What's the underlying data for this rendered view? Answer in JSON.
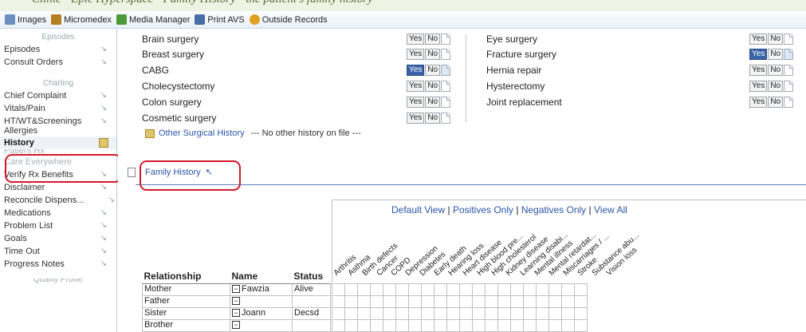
{
  "banner": {
    "text": "Clinic - Epic Hyperspace - Family History - the patient's family history"
  },
  "toolbar": {
    "items": [
      {
        "label": "Images",
        "icon": "images-icon",
        "color": "#6b8fbf"
      },
      {
        "label": "Micromedex",
        "icon": "micromedex-icon",
        "color": "#b3801f"
      },
      {
        "label": "Media Manager",
        "icon": "media-manager-icon",
        "color": "#4a9a3a"
      },
      {
        "label": "Print AVS",
        "icon": "printer-icon",
        "color": "#4a6fa6"
      },
      {
        "label": "Outside Records",
        "icon": "outside-records-icon",
        "color": "#e0a020"
      }
    ]
  },
  "sidebar": {
    "section_episodes": "Episodes",
    "episodes": "Episodes",
    "consult_orders": "Consult Orders",
    "section_charting": "Charting",
    "chief_complaint": "Chief Complaint",
    "vitals_pain": "Vitals/Pain",
    "htwt": "HT/WT&Screenings",
    "allergies": "Allergies",
    "history": "History",
    "patient_hx": "Patient Hx",
    "care_everywhere": "Care Everywhere",
    "verify_rx": "Verify Rx Benefits",
    "disclaimer": "Disclaimer",
    "reconcile": "Reconcile Dispens...",
    "medications": "Medications",
    "problem_list": "Problem List",
    "goals": "Goals",
    "time_out": "Time Out",
    "progress_notes": "Progress Notes",
    "section_bottom": "Quality Profile"
  },
  "surgical": {
    "left": [
      {
        "name": "Brain surgery",
        "selected": ""
      },
      {
        "name": "Breast surgery",
        "selected": ""
      },
      {
        "name": "CABG",
        "selected": "Yes"
      },
      {
        "name": "Cholecystectomy",
        "selected": ""
      },
      {
        "name": "Colon surgery",
        "selected": ""
      },
      {
        "name": "Cosmetic surgery",
        "selected": ""
      }
    ],
    "right": [
      {
        "name": "Eye surgery",
        "selected": ""
      },
      {
        "name": "Fracture surgery",
        "selected": "Yes"
      },
      {
        "name": "Hernia repair",
        "selected": ""
      },
      {
        "name": "Hysterectomy",
        "selected": ""
      },
      {
        "name": "Joint replacement",
        "selected": ""
      }
    ],
    "yes_label": "Yes",
    "no_label": "No",
    "other_link": "Other Surgical History",
    "other_note": "--- No other history on file ---"
  },
  "family": {
    "section_title": "Family History",
    "view_default": "Default View",
    "view_positives": "Positives Only",
    "view_negatives": "Negatives Only",
    "view_all": "View All",
    "sep": "|",
    "headers": {
      "relationship": "Relationship",
      "name": "Name",
      "status": "Status"
    },
    "rows": [
      {
        "relationship": "Mother",
        "name": "Fawzia",
        "status": "Alive"
      },
      {
        "relationship": "Father",
        "name": "",
        "status": ""
      },
      {
        "relationship": "Sister",
        "name": "Joann",
        "status": "Decsd"
      },
      {
        "relationship": "Brother",
        "name": "",
        "status": ""
      }
    ],
    "conditions": [
      "Arthritis",
      "Asthma",
      "Birth defects",
      "Cancer",
      "COPD",
      "Depression",
      "Diabetes",
      "Early death",
      "Hearing loss",
      "Heart disease",
      "High blood pre...",
      "High cholesterol",
      "Kidney disease",
      "Learning disabi...",
      "Mental illness",
      "Mental retardat...",
      "Miscarriages / ...",
      "Stroke",
      "Substance abu...",
      "Vision loss"
    ]
  },
  "colors": {
    "accent": "#3a63a8",
    "highlight_circle": "#d2192b",
    "link": "#2b56a6"
  }
}
